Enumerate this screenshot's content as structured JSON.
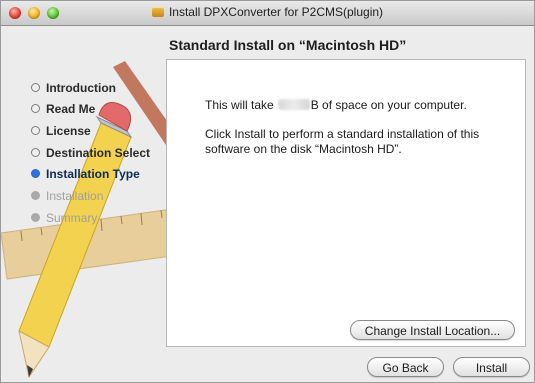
{
  "window": {
    "title": "Install DPXConverter for P2CMS(plugin)",
    "heading": "Standard Install on “Macintosh HD”"
  },
  "sidebar": {
    "steps": [
      {
        "label": "Introduction",
        "state": "done"
      },
      {
        "label": "Read Me",
        "state": "done"
      },
      {
        "label": "License",
        "state": "done"
      },
      {
        "label": "Destination Select",
        "state": "done"
      },
      {
        "label": "Installation Type",
        "state": "current"
      },
      {
        "label": "Installation",
        "state": "future"
      },
      {
        "label": "Summary",
        "state": "future"
      }
    ]
  },
  "panel": {
    "space_prefix": "This will take",
    "space_suffix": "B of space on your computer.",
    "instruction": "Click Install to perform a standard installation of this software on the disk “Macintosh HD”.",
    "change_location_button": "Change Install Location..."
  },
  "footer": {
    "back_button": "Go Back",
    "install_button": "Install"
  },
  "icons": {
    "close": "close-icon",
    "minimize": "minimize-icon",
    "zoom": "zoom-icon",
    "package": "package-icon"
  },
  "colors": {
    "accent": "#2d73e0",
    "current_step_text": "#0c2b58",
    "future_step_text": "#9f9f9f"
  }
}
